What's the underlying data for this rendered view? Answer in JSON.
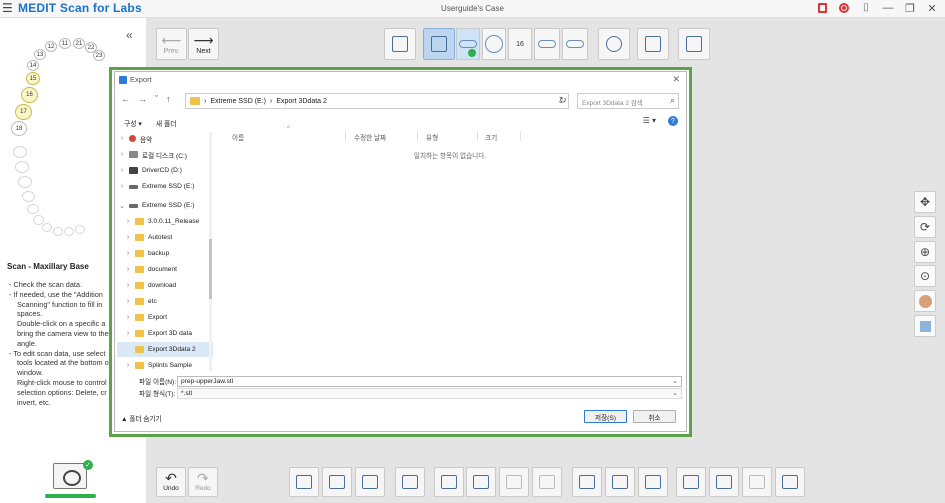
{
  "app": {
    "title": "MEDIT Scan for Labs",
    "case_title": "Userguide's Case"
  },
  "toolbar": {
    "prev_label": "Prev.",
    "next_label": "Next",
    "jaw_count_label": "16"
  },
  "bottom_toolbar": {
    "undo_label": "Undo",
    "redo_label": "Redo"
  },
  "teeth": {
    "upper_right": [
      "11",
      "12",
      "13",
      "14",
      "15",
      "16",
      "17",
      "18"
    ],
    "upper_left": [
      "21",
      "22",
      "23"
    ]
  },
  "guide": {
    "title": "Scan - Maxillary Base",
    "lines": [
      "- Check the scan data.",
      "- If needed, use the \"Addition",
      "Scanning\" function to fill in",
      "spaces.",
      "Double-click on a specific a",
      "bring the camera view to the",
      "angle.",
      "- To edit scan data, use select",
      "tools located at the bottom o",
      "window.",
      "Right-click mouse to control",
      "selection options: Delete, cr",
      "invert, etc."
    ]
  },
  "dialog": {
    "title": "Export",
    "address": {
      "drive": "Extreme SSD (E:)",
      "folder": "Export 3Ddata 2"
    },
    "search_placeholder": "Export 3Ddata 2 검색",
    "organize_label": "구성 ▾",
    "new_folder_label": "새 폴더",
    "nav_items": [
      {
        "label": "음악",
        "icon": "music"
      },
      {
        "label": "로컬 디스크 (C:)",
        "icon": "disk"
      },
      {
        "label": "DriverCD (D:)",
        "icon": "cd"
      },
      {
        "label": "Extreme SSD (E:)",
        "icon": "drive"
      },
      {
        "label": "Extreme SSD (E:)",
        "icon": "drive"
      },
      {
        "label": "3.0.0.11_Release",
        "icon": "folder"
      },
      {
        "label": "Autotest",
        "icon": "folder"
      },
      {
        "label": "backup",
        "icon": "folder"
      },
      {
        "label": "document",
        "icon": "folder"
      },
      {
        "label": "download",
        "icon": "folder"
      },
      {
        "label": "etc",
        "icon": "folder"
      },
      {
        "label": "Export",
        "icon": "folder"
      },
      {
        "label": "Export 3D data",
        "icon": "folder"
      },
      {
        "label": "Export 3Ddata 2",
        "icon": "folder"
      },
      {
        "label": "Splints Sample",
        "icon": "folder"
      }
    ],
    "columns": {
      "name": "이름",
      "modified": "수정한 날짜",
      "type": "유형",
      "size": "크기"
    },
    "empty_message": "일치하는 항목이 없습니다.",
    "filename_label": "파일 이름(N):",
    "filename_value": "prep-upperJaw.stl",
    "filetype_label": "파일 형식(T):",
    "filetype_value": "*.stl",
    "hide_folders_label": "▲ 폴더 숨기기",
    "save_label": "저장(S)",
    "cancel_label": "취소"
  },
  "colors": {
    "accent": "#1a73c9",
    "highlight_frame": "#5da246",
    "success": "#2eb04a",
    "record": "#d33333"
  }
}
